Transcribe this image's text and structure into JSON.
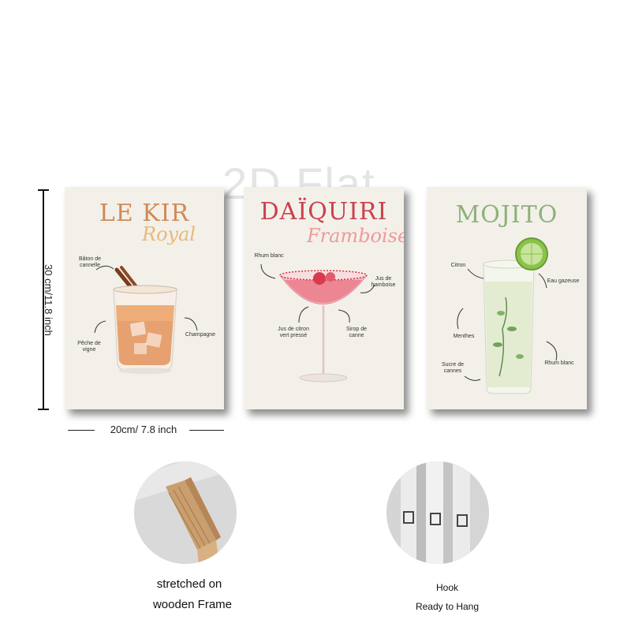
{
  "watermark": "2D Flat",
  "dimensions": {
    "height_label": "30 cm/11.8 inch",
    "width_label": "20cm/ 7.8 inch"
  },
  "posters": [
    {
      "title": "LE KIR",
      "subtitle": "Royal",
      "accent": "#d08a55",
      "subtitle_color": "#e8b978",
      "labels": [
        "Bâton de cannelle",
        "Pêche de vigne",
        "Champagne"
      ]
    },
    {
      "title": "DAÏQUIRI",
      "subtitle": "Framboise",
      "accent": "#c9424d",
      "subtitle_color": "#ef9a9a",
      "labels": [
        "Rhum blanc",
        "Jus de framboise",
        "Jus de citron vert pressé",
        "Sirop de canne"
      ]
    },
    {
      "title": "MOJITO",
      "subtitle": "",
      "accent": "#8fb07a",
      "labels": [
        "Citron",
        "Eau gazeuse",
        "Menthes",
        "Rhum blanc",
        "Sucre de cannes"
      ]
    }
  ],
  "features": [
    {
      "line1": "stretched on",
      "line2": "wooden Frame",
      "icon": "wooden-frame"
    },
    {
      "line1": "Hook",
      "line2": "Ready to Hang",
      "icon": "hook"
    }
  ]
}
